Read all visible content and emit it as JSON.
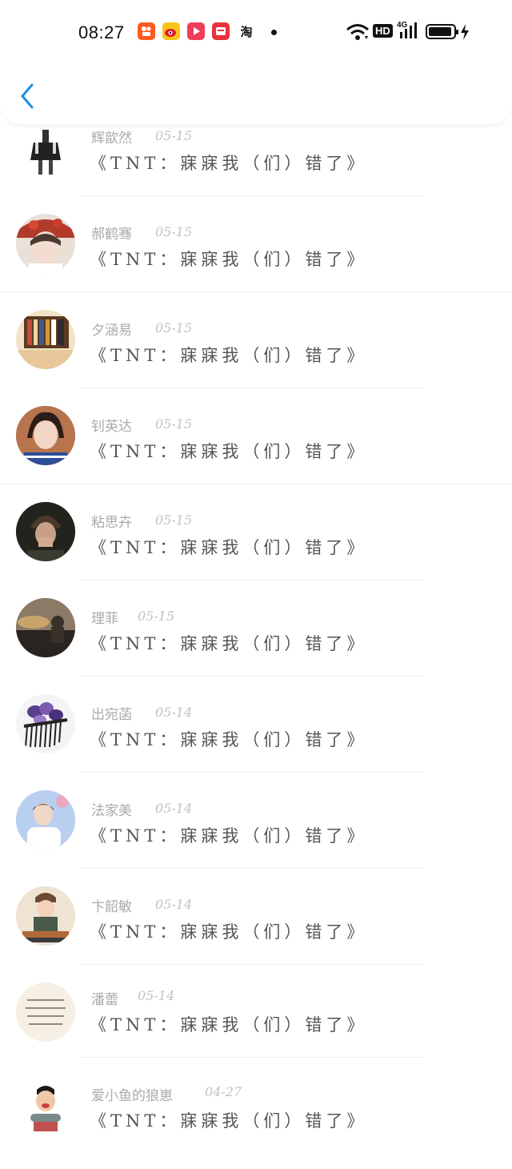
{
  "status_bar": {
    "time": "08:27",
    "apps": [
      "kuaishou-icon",
      "weibo-icon",
      "video-icon",
      "news-icon",
      "taobao-icon"
    ],
    "taobao_label": "淘",
    "hd_label": "HD",
    "signal_label": "4G"
  },
  "header": {
    "back_icon": "chevron-left-icon",
    "accent": "#1e8fe1"
  },
  "items": [
    {
      "name": "辉歆然",
      "date": "05-15",
      "title": "《TNT：寐寐我（们）错了》"
    },
    {
      "name": "郝鹤骞",
      "date": "05-15",
      "title": "《TNT：寐寐我（们）错了》"
    },
    {
      "name": "夕涵易",
      "date": "05-15",
      "title": "《TNT：寐寐我（们）错了》"
    },
    {
      "name": "钊英达",
      "date": "05-15",
      "title": "《TNT：寐寐我（们）错了》"
    },
    {
      "name": "粘思卉",
      "date": "05-15",
      "title": "《TNT：寐寐我（们）错了》"
    },
    {
      "name": "理菲",
      "date": "05-15",
      "title": "《TNT：寐寐我（们）错了》"
    },
    {
      "name": "出宛菡",
      "date": "05-14",
      "title": "《TNT：寐寐我（们）错了》"
    },
    {
      "name": "法家美",
      "date": "05-14",
      "title": "《TNT：寐寐我（们）错了》"
    },
    {
      "name": "卞韶敏",
      "date": "05-14",
      "title": "《TNT：寐寐我（们）错了》"
    },
    {
      "name": "潘蕾",
      "date": "05-14",
      "title": "《TNT：寐寐我（们）错了》"
    },
    {
      "name": "爱小鱼的狼崽",
      "date": "04-27",
      "title": "《TNT：寐寐我（们）错了》"
    }
  ]
}
